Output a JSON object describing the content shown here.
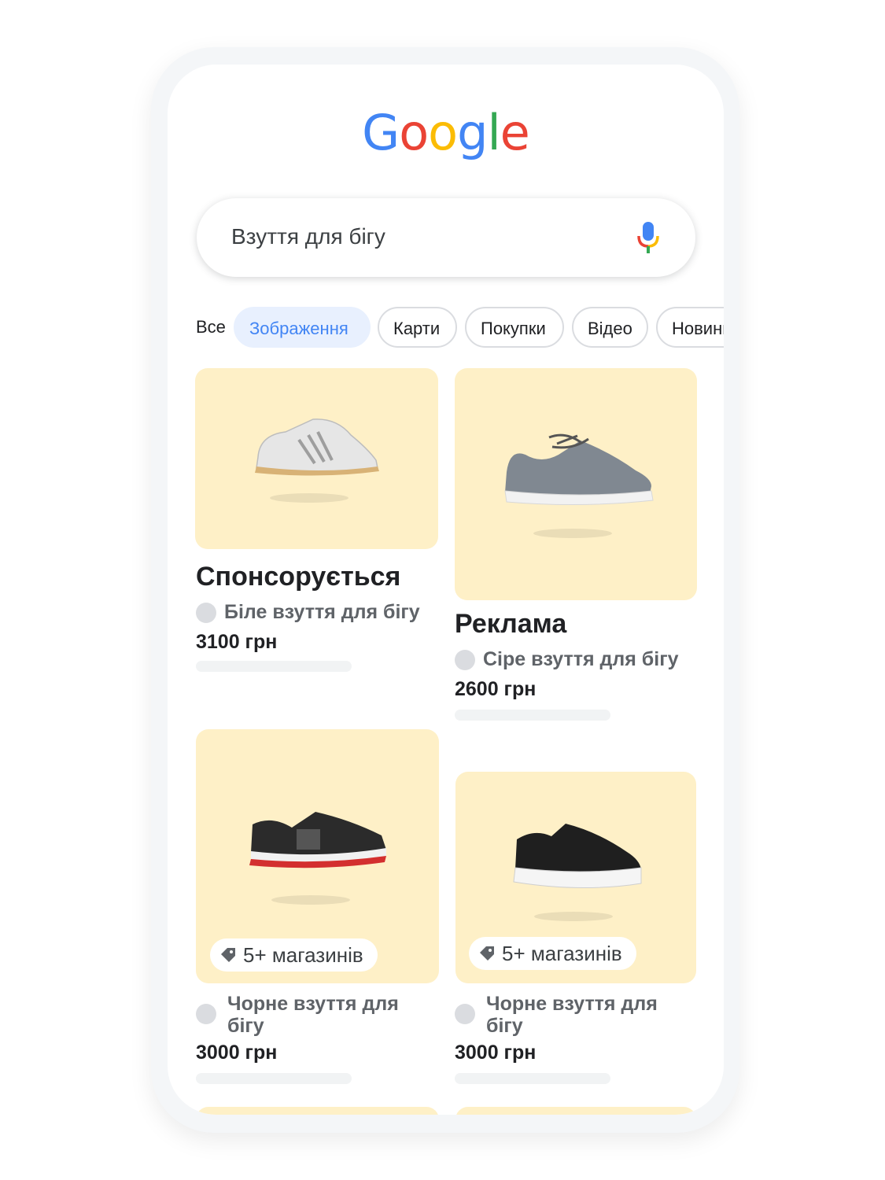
{
  "logo": {
    "letters": [
      "G",
      "o",
      "o",
      "g",
      "l",
      "e"
    ],
    "colors": [
      "#4285F4",
      "#EA4335",
      "#FBBC05",
      "#4285F4",
      "#34A853",
      "#EA4335"
    ]
  },
  "search": {
    "query": "Взуття для бігу",
    "mic_icon": "microphone-icon"
  },
  "tabs": [
    {
      "label": "Все",
      "active": false
    },
    {
      "label": "Зображення",
      "active": true
    },
    {
      "label": "Карти",
      "active": false
    },
    {
      "label": "Покупки",
      "active": false
    },
    {
      "label": "Відео",
      "active": false
    },
    {
      "label": "Новини",
      "active": false
    }
  ],
  "results": [
    {
      "ad_label": "Спонсорується",
      "title": "Біле взуття для бігу",
      "price": "3100 грн"
    },
    {
      "ad_label": "Реклама",
      "title": "Сіре взуття для бігу",
      "price": "2600 грн"
    },
    {
      "store_badge": "5+ магазинів",
      "title": "Чорне взуття для бігу",
      "price": "3000 грн"
    },
    {
      "store_badge": "5+ магазинів",
      "title": "Чорне взуття для бігу",
      "price": "3000 грн"
    }
  ],
  "colors": {
    "card_bg": "#FEF0C7",
    "active_tab_bg": "#E8F0FE",
    "active_tab_text": "#4285F4"
  }
}
